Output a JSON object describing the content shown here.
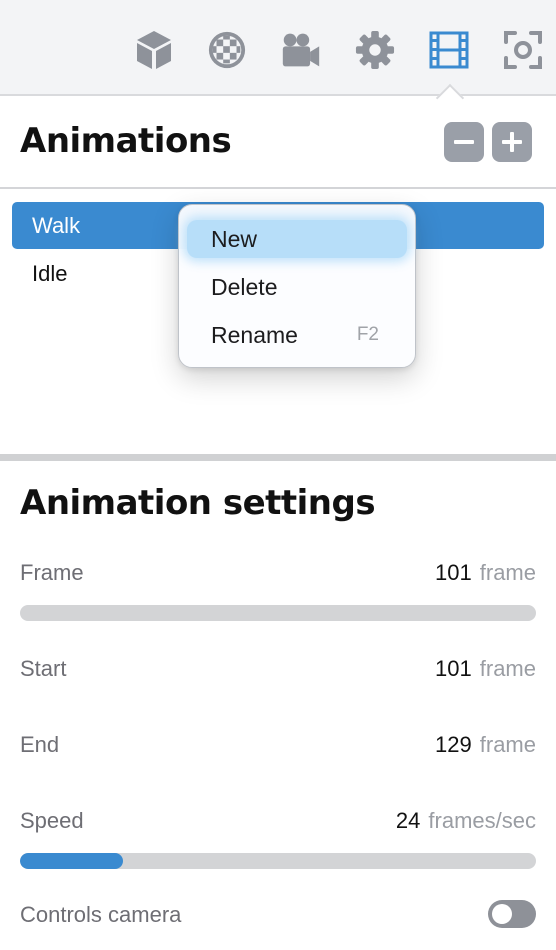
{
  "toolbar": {
    "icons": [
      "cube-icon",
      "material-ball-icon",
      "video-camera-icon",
      "gear-icon",
      "film-strip-icon",
      "focus-frame-icon"
    ],
    "active_icon": "film-strip-icon",
    "active_color": "#3a8ad0",
    "icon_color": "#8e929a"
  },
  "animations": {
    "title": "Animations",
    "items": [
      {
        "label": "Walk",
        "selected": true
      },
      {
        "label": "Idle",
        "selected": false
      }
    ]
  },
  "context_menu": {
    "items": [
      {
        "label": "New",
        "shortcut": "",
        "highlighted": true
      },
      {
        "label": "Delete",
        "shortcut": ""
      },
      {
        "label": "Rename",
        "shortcut": "F2"
      }
    ]
  },
  "settings": {
    "title": "Animation settings",
    "frame": {
      "label": "Frame",
      "value": "101",
      "unit": "frame",
      "progress": 0
    },
    "start": {
      "label": "Start",
      "value": "101",
      "unit": "frame"
    },
    "end": {
      "label": "End",
      "value": "129",
      "unit": "frame"
    },
    "speed": {
      "label": "Speed",
      "value": "24",
      "unit": "frames/sec",
      "progress": 0.2
    },
    "controls_camera": {
      "label": "Controls camera",
      "on": false
    }
  },
  "colors": {
    "accent": "#3a8ad0",
    "menu_highlight": "#b7def9"
  }
}
